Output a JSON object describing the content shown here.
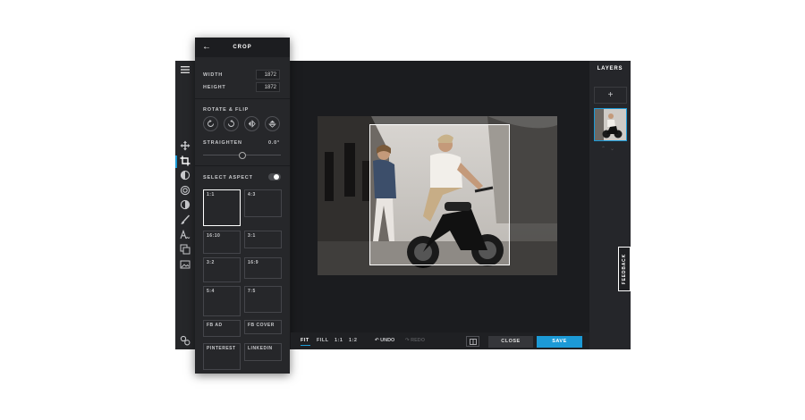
{
  "panel": {
    "title": "CROP",
    "width_label": "WIDTH",
    "width_value": "1872",
    "height_label": "HEIGHT",
    "height_value": "1872",
    "rotate_flip_label": "ROTATE & FLIP",
    "straighten_label": "STRAIGHTEN",
    "straighten_value": "0.0°",
    "select_aspect_label": "SELECT ASPECT",
    "select_aspect_toggle": "on",
    "aspects": [
      "1:1",
      "4:3",
      "16:10",
      "3:1",
      "3:2",
      "16:9",
      "5:4",
      "7:5",
      "FB AD",
      "FB COVER",
      "PINTEREST",
      "LINKEDIN"
    ],
    "selected_aspect": "1:1"
  },
  "toolstrip": {
    "icons": [
      "menu-icon",
      "move-icon",
      "crop-icon",
      "exposure-icon",
      "filter-icon",
      "contrast-icon",
      "brush-icon",
      "text-icon",
      "overlay-icon",
      "image-icon",
      "settings-icon"
    ],
    "active": "crop-icon"
  },
  "bottom": {
    "fit": "FIT",
    "fill": "FILL",
    "one_one": "1:1",
    "one_two": "1:2",
    "undo": "UNDO",
    "redo": "REDO",
    "close": "CLOSE",
    "save": "SAVE"
  },
  "layers": {
    "title": "LAYERS",
    "add": "+"
  },
  "feedback": "FEEDBACK",
  "colors": {
    "accent": "#1c9ad6",
    "panel": "#26272a",
    "background": "#1f2023"
  }
}
